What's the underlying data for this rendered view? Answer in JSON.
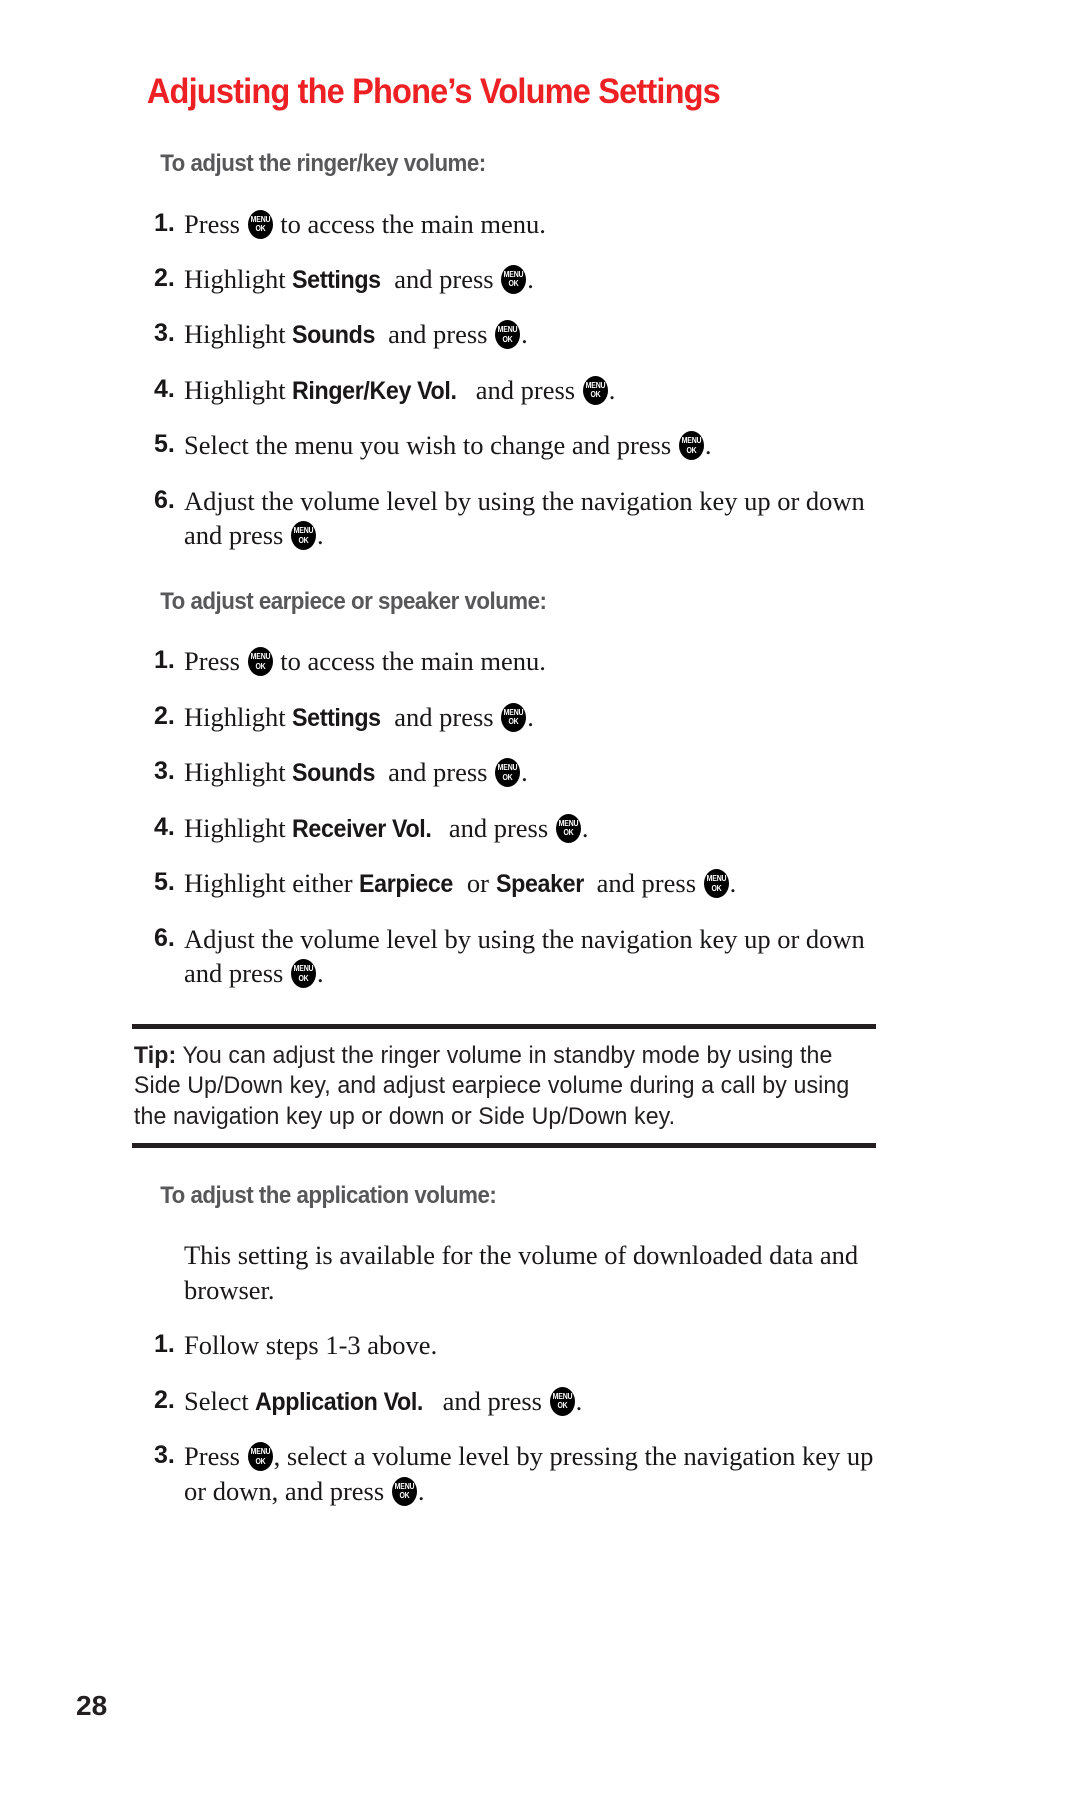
{
  "document": {
    "title": "Adjusting the Phone’s Volume Settings",
    "page_number": "28",
    "title_color": "#ed2024",
    "heading_color": "#58585a",
    "body_color": "#1a1718"
  },
  "icons": {
    "menu_ok": {
      "line1": "MENU",
      "line2": "OK"
    }
  },
  "sections": [
    {
      "heading": "To adjust the ringer/key volume:",
      "steps": [
        {
          "num": "1.",
          "parts": [
            {
              "t": "text",
              "v": "Press "
            },
            {
              "t": "key"
            },
            {
              "t": "text",
              "v": " to access the main menu."
            }
          ]
        },
        {
          "num": "2.",
          "parts": [
            {
              "t": "text",
              "v": "Highlight "
            },
            {
              "t": "emph",
              "v": "Settings"
            },
            {
              "t": "text",
              "v": " and press "
            },
            {
              "t": "key"
            },
            {
              "t": "text",
              "v": "."
            }
          ]
        },
        {
          "num": "3.",
          "parts": [
            {
              "t": "text",
              "v": "Highlight "
            },
            {
              "t": "emph",
              "v": "Sounds"
            },
            {
              "t": "text",
              "v": " and press "
            },
            {
              "t": "key"
            },
            {
              "t": "text",
              "v": "."
            }
          ]
        },
        {
          "num": "4.",
          "parts": [
            {
              "t": "text",
              "v": "Highlight "
            },
            {
              "t": "emph",
              "v": "Ringer/Key Vol."
            },
            {
              "t": "text",
              "v": " and press "
            },
            {
              "t": "key"
            },
            {
              "t": "text",
              "v": "."
            }
          ]
        },
        {
          "num": "5.",
          "parts": [
            {
              "t": "text",
              "v": "Select the menu you wish to change and press "
            },
            {
              "t": "key"
            },
            {
              "t": "text",
              "v": "."
            }
          ]
        },
        {
          "num": "6.",
          "parts": [
            {
              "t": "text",
              "v": "Adjust the volume level by using the navigation key up or down and press "
            },
            {
              "t": "key"
            },
            {
              "t": "text",
              "v": "."
            }
          ]
        }
      ]
    },
    {
      "heading": "To adjust earpiece or speaker volume:",
      "steps": [
        {
          "num": "1.",
          "parts": [
            {
              "t": "text",
              "v": "Press "
            },
            {
              "t": "key"
            },
            {
              "t": "text",
              "v": " to access the main menu."
            }
          ]
        },
        {
          "num": "2.",
          "parts": [
            {
              "t": "text",
              "v": "Highlight "
            },
            {
              "t": "emph",
              "v": "Settings"
            },
            {
              "t": "text",
              "v": " and press "
            },
            {
              "t": "key"
            },
            {
              "t": "text",
              "v": "."
            }
          ]
        },
        {
          "num": "3.",
          "parts": [
            {
              "t": "text",
              "v": "Highlight "
            },
            {
              "t": "emph",
              "v": "Sounds"
            },
            {
              "t": "text",
              "v": " and press "
            },
            {
              "t": "key"
            },
            {
              "t": "text",
              "v": "."
            }
          ]
        },
        {
          "num": "4.",
          "parts": [
            {
              "t": "text",
              "v": "Highlight "
            },
            {
              "t": "emph",
              "v": "Receiver Vol."
            },
            {
              "t": "text",
              "v": " and press "
            },
            {
              "t": "key"
            },
            {
              "t": "text",
              "v": "."
            }
          ]
        },
        {
          "num": "5.",
          "parts": [
            {
              "t": "text",
              "v": "Highlight either "
            },
            {
              "t": "emph",
              "v": "Earpiece"
            },
            {
              "t": "text",
              "v": " or "
            },
            {
              "t": "emph",
              "v": "Speaker"
            },
            {
              "t": "text",
              "v": " and press "
            },
            {
              "t": "key"
            },
            {
              "t": "text",
              "v": "."
            }
          ]
        },
        {
          "num": "6.",
          "parts": [
            {
              "t": "text",
              "v": "Adjust the volume level by using the navigation key up or down and press "
            },
            {
              "t": "key"
            },
            {
              "t": "text",
              "v": "."
            }
          ]
        }
      ]
    },
    {
      "heading": "To adjust the application volume:",
      "intro": "This setting is available for the volume of downloaded data and browser.",
      "steps": [
        {
          "num": "1.",
          "parts": [
            {
              "t": "text",
              "v": "Follow steps 1-3 above."
            }
          ]
        },
        {
          "num": "2.",
          "parts": [
            {
              "t": "text",
              "v": "Select "
            },
            {
              "t": "emph",
              "v": "Application Vol."
            },
            {
              "t": "text",
              "v": " and press "
            },
            {
              "t": "key"
            },
            {
              "t": "text",
              "v": "."
            }
          ]
        },
        {
          "num": "3.",
          "parts": [
            {
              "t": "text",
              "v": "Press "
            },
            {
              "t": "key"
            },
            {
              "t": "text",
              "v": ", select a volume level by pressing the navigation key up or down, and press "
            },
            {
              "t": "key"
            },
            {
              "t": "text",
              "v": "."
            }
          ]
        }
      ]
    }
  ],
  "tip": {
    "label": "Tip:",
    "text": " You can adjust the ringer volume in standby mode by using the Side Up/Down key, and adjust earpiece volume during a call by using the navigation key up or down or Side Up/Down key."
  }
}
